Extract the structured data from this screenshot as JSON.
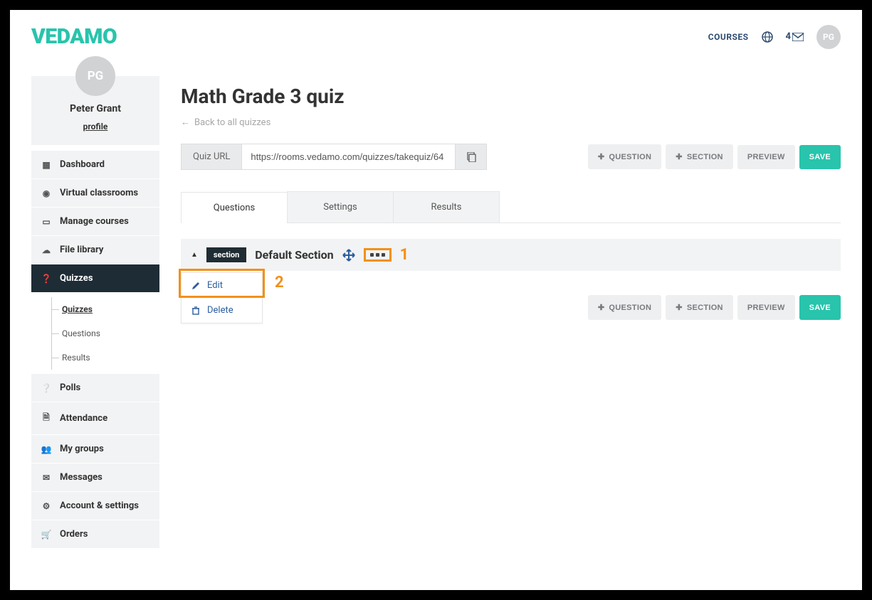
{
  "brand": "VEDAMO",
  "topnav": {
    "courses": "COURSES",
    "notif_count": "4",
    "avatar_initials": "PG"
  },
  "user": {
    "avatar_initials": "PG",
    "name": "Peter Grant",
    "profile_link": "profile"
  },
  "sidebar": {
    "items": [
      {
        "label": "Dashboard",
        "icon": "grid"
      },
      {
        "label": "Virtual classrooms",
        "icon": "circle"
      },
      {
        "label": "Manage courses",
        "icon": "book"
      },
      {
        "label": "File library",
        "icon": "cloud"
      },
      {
        "label": "Quizzes",
        "icon": "help",
        "active": true
      },
      {
        "label": "Polls",
        "icon": "help2"
      },
      {
        "label": "Attendance",
        "icon": "doc"
      },
      {
        "label": "My groups",
        "icon": "group"
      },
      {
        "label": "Messages",
        "icon": "mail"
      },
      {
        "label": "Account & settings",
        "icon": "gear"
      },
      {
        "label": "Orders",
        "icon": "cart"
      }
    ],
    "sub": [
      {
        "label": "Quizzes",
        "active": true
      },
      {
        "label": "Questions"
      },
      {
        "label": "Results"
      }
    ]
  },
  "page": {
    "title": "Math Grade 3 quiz",
    "back": "Back to all quizzes",
    "url_label": "Quiz URL",
    "url_value": "https://rooms.vedamo.com/quizzes/takequiz/64"
  },
  "buttons": {
    "question": "QUESTION",
    "section": "SECTION",
    "preview": "PREVIEW",
    "save": "SAVE"
  },
  "tabs": {
    "questions": "Questions",
    "settings": "Settings",
    "results": "Results"
  },
  "section": {
    "tag": "section",
    "title": "Default Section",
    "menu_edit": "Edit",
    "menu_delete": "Delete"
  },
  "annotations": {
    "one": "1",
    "two": "2"
  }
}
